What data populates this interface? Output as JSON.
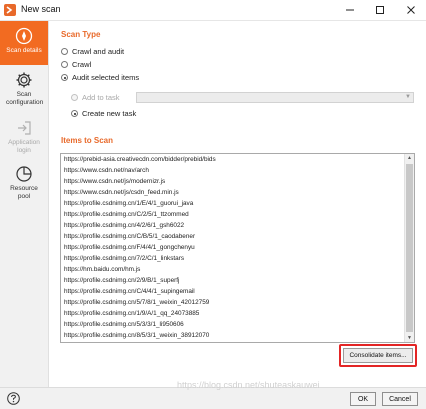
{
  "window": {
    "title": "New scan"
  },
  "sidebar": {
    "items": [
      {
        "label": "Scan details",
        "icon": "compass-icon"
      },
      {
        "label": "Scan configuration",
        "icon": "gear-icon"
      },
      {
        "label": "Application login",
        "icon": "login-arrow-icon"
      },
      {
        "label": "Resource pool",
        "icon": "pie-chart-icon"
      }
    ]
  },
  "scan_type": {
    "title": "Scan Type",
    "options": [
      "Crawl and audit",
      "Crawl",
      "Audit selected items"
    ],
    "selected": "Audit selected items",
    "sub_options": [
      "Add to task",
      "Create new task"
    ],
    "sub_selected": "Create new task",
    "task_select_value": ""
  },
  "items_to_scan": {
    "title": "Items to Scan",
    "urls": [
      "https://prebid-asia.creativecdn.com/bidder/prebid/bids",
      "https://www.csdn.net/nav/arch",
      "https://www.csdn.net/js/modernizr.js",
      "https://www.csdn.net/js/csdn_feed.min.js",
      "https://profile.csdnimg.cn/1/E/4/1_guorui_java",
      "https://profile.csdnimg.cn/C/2/5/1_ttzommed",
      "https://profile.csdnimg.cn/4/2/6/1_gsh6022",
      "https://profile.csdnimg.cn/C/B/5/1_caodabener",
      "https://profile.csdnimg.cn/F/4/4/1_gongchenyu",
      "https://profile.csdnimg.cn/7/2/C/1_linkstars",
      "https://hm.baidu.com/hm.js",
      "https://profile.csdnimg.cn/2/9/B/1_superfj",
      "https://profile.csdnimg.cn/C/4/4/1_supingemail",
      "https://profile.csdnimg.cn/5/7/8/1_weixin_42012759",
      "https://profile.csdnimg.cn/1/9/A/1_qq_24073885",
      "https://profile.csdnimg.cn/5/3/3/1_li950606",
      "https://profile.csdnimg.cn/8/5/3/1_weixin_38912070"
    ],
    "consolidate_label": "Consolidate items..."
  },
  "footer": {
    "help_icon": "question-circle-icon",
    "ok_label": "OK",
    "cancel_label": "Cancel",
    "watermark": "https://blog.csdn.net/shuteaskauwei"
  },
  "colors": {
    "accent": "#f26b21",
    "section_title": "#e8692a",
    "highlight": "#e32525"
  }
}
